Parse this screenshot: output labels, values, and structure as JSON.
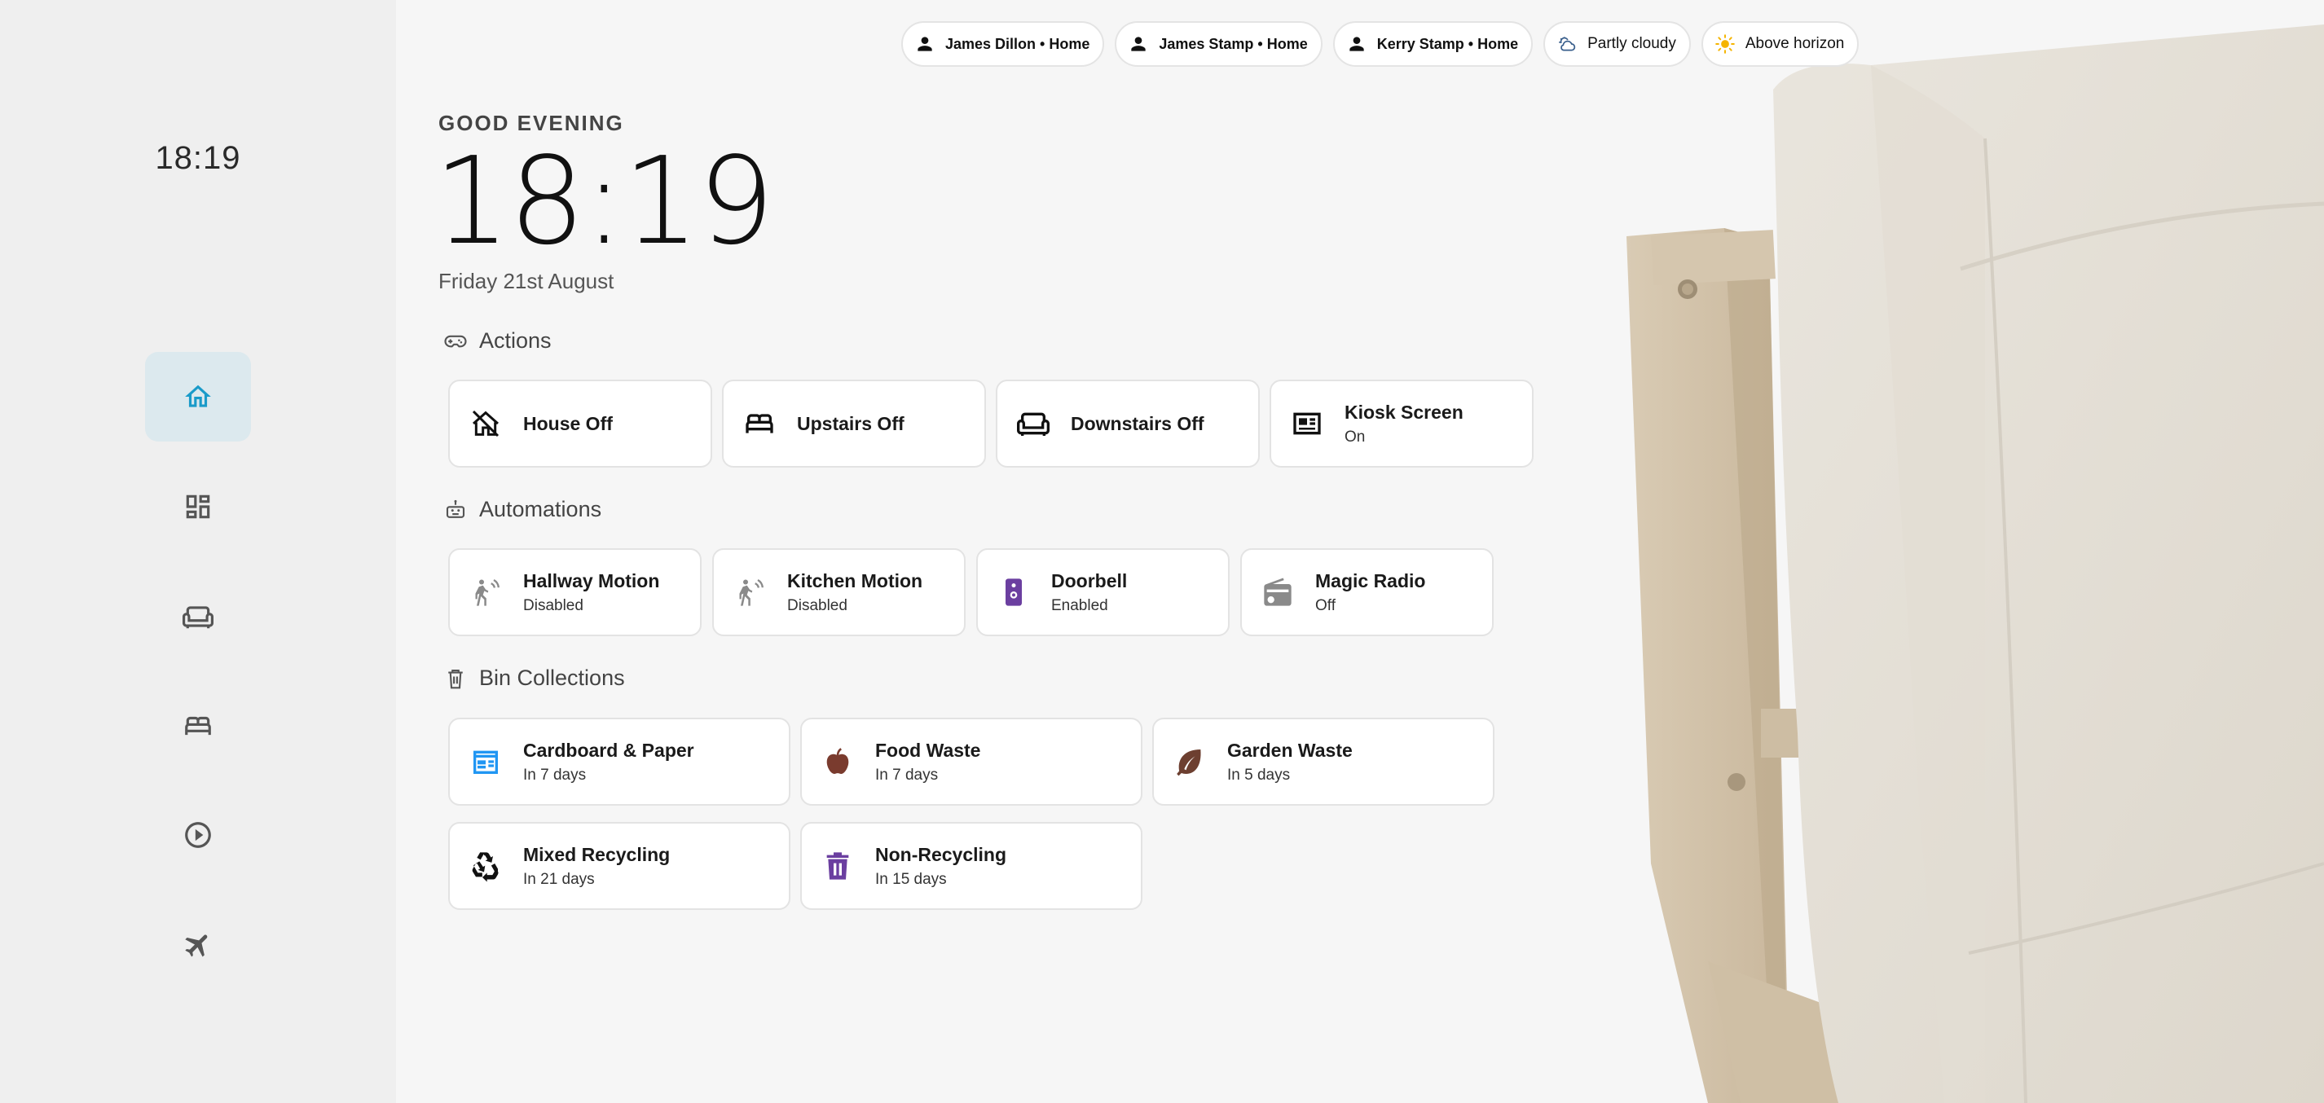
{
  "sidebar": {
    "clock": "18:19",
    "items": [
      {
        "icon": "home-icon",
        "active": true
      },
      {
        "icon": "dashboard-icon",
        "active": false
      },
      {
        "icon": "sofa-icon",
        "active": false
      },
      {
        "icon": "bed-icon",
        "active": false
      },
      {
        "icon": "play-circle-icon",
        "active": false
      },
      {
        "icon": "airplane-icon",
        "active": false
      }
    ]
  },
  "header": {
    "chips": [
      {
        "label": "James Dillon • Home",
        "icon": "person-icon"
      },
      {
        "label": "James Stamp • Home",
        "icon": "person-icon"
      },
      {
        "label": "Kerry Stamp • Home",
        "icon": "person-icon"
      },
      {
        "label": "Partly cloudy",
        "icon": "partly-cloudy-icon"
      },
      {
        "label": "Above horizon",
        "icon": "sun-icon"
      }
    ]
  },
  "hero": {
    "greeting": "GOOD EVENING",
    "time": "18:19",
    "date": "Friday 21st August"
  },
  "sections": {
    "actions": {
      "title": "Actions",
      "cards": [
        {
          "name": "House Off",
          "icon": "home-off-icon"
        },
        {
          "name": "Upstairs Off",
          "icon": "bed-icon"
        },
        {
          "name": "Downstairs Off",
          "icon": "sofa-icon"
        },
        {
          "name": "Kiosk Screen",
          "state": "On",
          "icon": "newspaper-icon"
        }
      ]
    },
    "automations": {
      "title": "Automations",
      "cards": [
        {
          "name": "Hallway Motion",
          "state": "Disabled",
          "icon": "motion-sensor-icon"
        },
        {
          "name": "Kitchen Motion",
          "state": "Disabled",
          "icon": "motion-sensor-icon"
        },
        {
          "name": "Doorbell",
          "state": "Enabled",
          "icon": "doorbell-icon"
        },
        {
          "name": "Magic Radio",
          "state": "Off",
          "icon": "radio-icon"
        }
      ]
    },
    "bins": {
      "title": "Bin Collections",
      "cards": [
        {
          "name": "Cardboard & Paper",
          "state": "In 7 days",
          "icon": "calendar-icon"
        },
        {
          "name": "Food Waste",
          "state": "In 7 days",
          "icon": "apple-icon"
        },
        {
          "name": "Garden Waste",
          "state": "In 5 days",
          "icon": "leaf-icon"
        },
        {
          "name": "Mixed Recycling",
          "state": "In 21 days",
          "icon": "recycle-icon"
        },
        {
          "name": "Non-Recycling",
          "state": "In 15 days",
          "icon": "trash-icon"
        }
      ]
    }
  },
  "colors": {
    "accent": "#1a9bc9",
    "doorbell": "#6b3fa0",
    "bin_food": "#7a3b2e",
    "bin_garden": "#6d3f30",
    "bin_card": "#2196f3",
    "bin_trash": "#6b3fa0"
  }
}
